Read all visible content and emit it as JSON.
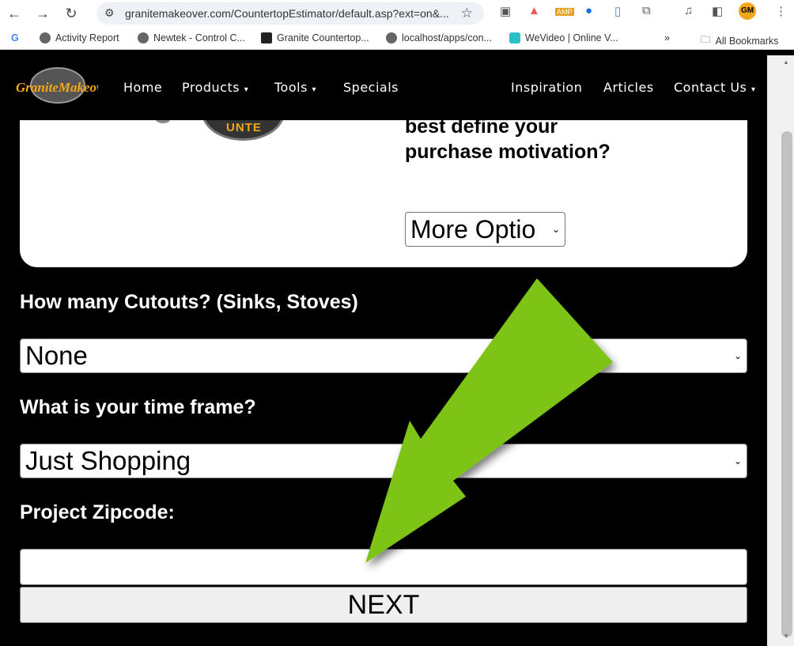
{
  "browser": {
    "url": "granitemakeover.com/CountertopEstimator/default.asp?ext=on&...",
    "profile": "GM",
    "bookmarks": [
      "Activity Report",
      "Newtek - Control C...",
      "Granite Countertop...",
      "localhost/apps/con...",
      "WeVideo | Online V..."
    ],
    "more": "»",
    "all_bookmarks": "All Bookmarks"
  },
  "nav": {
    "items": [
      "Home",
      "Products",
      "Tools",
      "Specials",
      "Inspiration",
      "Articles",
      "Contact Us"
    ],
    "caret": "▾"
  },
  "card": {
    "question": "best define your purchase motivation?",
    "select_value": "More Optio",
    "badge_text": "UNTE"
  },
  "form": {
    "cutouts_label": "How many Cutouts? (Sinks, Stoves)",
    "cutouts_value": "None",
    "timeframe_label": "What is your time frame?",
    "timeframe_value": "Just Shopping",
    "zip_label": "Project Zipcode:",
    "zip_value": "",
    "next_label": "NEXT"
  },
  "colors": {
    "arrow": "#7dc414",
    "logo": "#f2a71b"
  }
}
